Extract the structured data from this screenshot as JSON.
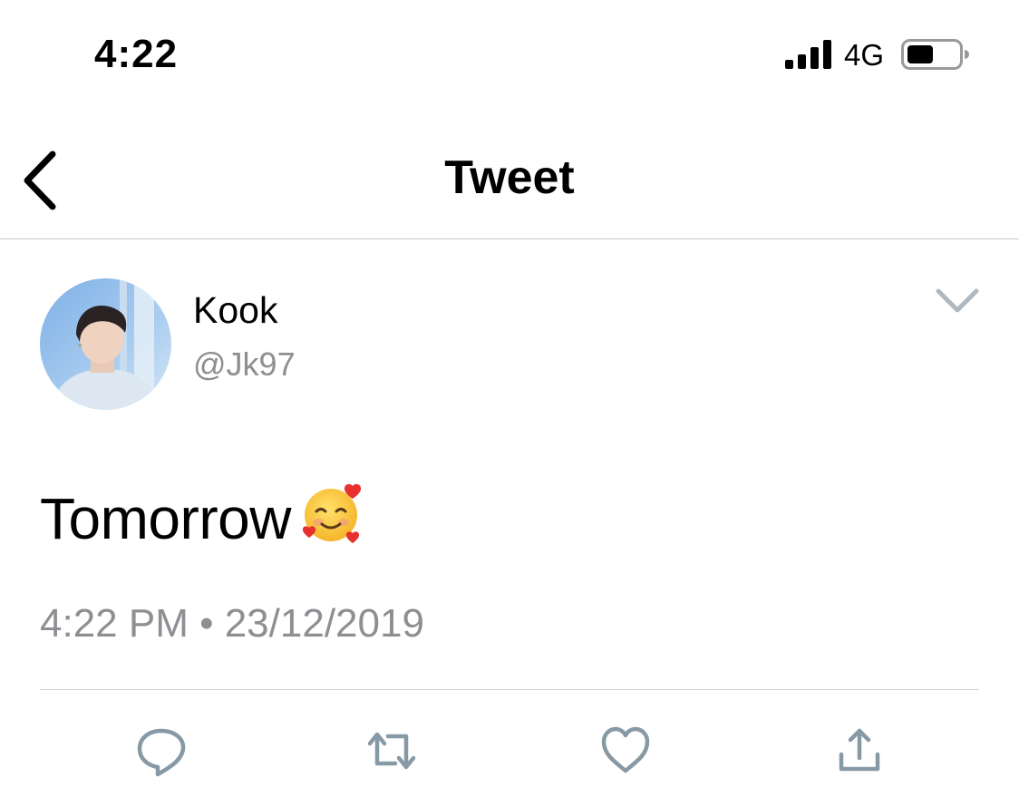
{
  "status_bar": {
    "time": "4:22",
    "network": "4G",
    "icons": [
      "signal-icon",
      "battery-icon"
    ]
  },
  "nav": {
    "title": "Tweet",
    "back_icon": "chevron-left-icon"
  },
  "tweet": {
    "display_name": "Kook",
    "handle": "@Jk97",
    "text": "Tomorrow",
    "emoji": "smiling-face-with-hearts",
    "timestamp": "4:22 PM • 23/12/2019",
    "more_icon": "chevron-down-icon"
  },
  "actions": [
    {
      "icon": "reply-icon"
    },
    {
      "icon": "retweet-icon"
    },
    {
      "icon": "like-icon"
    },
    {
      "icon": "share-icon"
    }
  ],
  "colors": {
    "icon_gray": "#8899a6",
    "secondary_text": "#8e8e93",
    "separator": "#c6c6c8"
  }
}
